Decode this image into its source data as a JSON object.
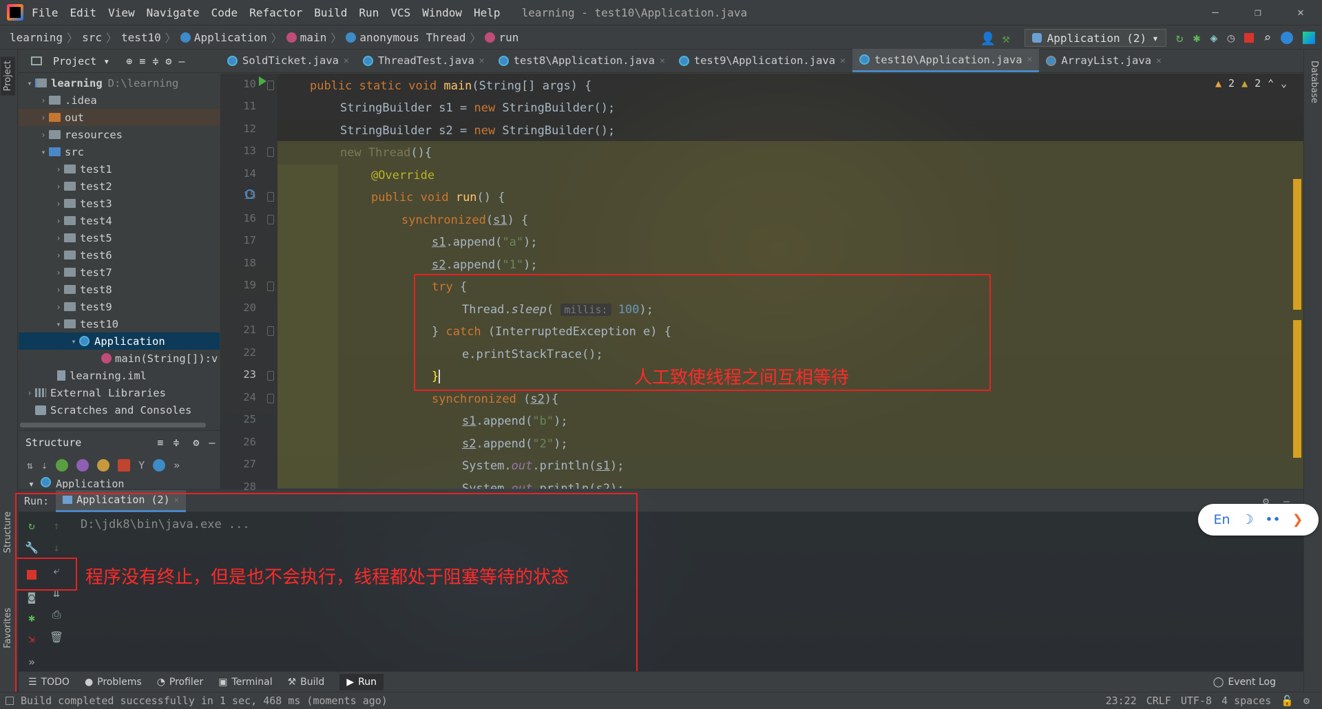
{
  "titlebar": {
    "menu": [
      "File",
      "Edit",
      "View",
      "Navigate",
      "Code",
      "Refactor",
      "Build",
      "Run",
      "VCS",
      "Window",
      "Help"
    ],
    "title": "learning - test10\\Application.java",
    "win_min": "—",
    "win_max": "❐",
    "win_close": "✕"
  },
  "navbar": {
    "breadcrumbs": [
      "learning",
      "src",
      "test10",
      "Application",
      "main",
      "anonymous Thread",
      "run"
    ],
    "run_config": "Application (2)"
  },
  "project_panel": {
    "title": "Project",
    "root_name": "learning",
    "root_path": "D:\\learning",
    "items": [
      ".idea",
      "out",
      "resources",
      "src",
      "test1",
      "test2",
      "test3",
      "test4",
      "test5",
      "test6",
      "test7",
      "test8",
      "test9",
      "test10",
      "Application",
      "main(String[]):v",
      "learning.iml",
      "External Libraries",
      "Scratches and Consoles"
    ]
  },
  "structure_panel": {
    "title": "Structure",
    "root_item": "Application"
  },
  "editor": {
    "tabs": [
      "SoldTicket.java",
      "ThreadTest.java",
      "test8\\Application.java",
      "test9\\Application.java",
      "test10\\Application.java",
      "ArrayList.java"
    ],
    "active_tab": "test10\\Application.java",
    "warnings": "2",
    "weak_warnings": "2",
    "line_numbers": [
      "10",
      "11",
      "12",
      "13",
      "14",
      "15",
      "16",
      "17",
      "18",
      "19",
      "20",
      "21",
      "22",
      "23",
      "24",
      "25",
      "26",
      "27",
      "28"
    ],
    "current_line": "23",
    "code": {
      "l10_a": "public static void ",
      "l10_fn": "main",
      "l10_b": "(String[] args) {",
      "l11": "StringBuilder s1 = ",
      "l11_kw": "new",
      "l11_b": " StringBuilder();",
      "l12": "StringBuilder s2 = ",
      "l12_kw": "new",
      "l12_b": " StringBuilder();",
      "l13_dim": "new Thread",
      "l13_b": "(){",
      "l14": "@Override",
      "l15_a": "public void ",
      "l15_fn": "run",
      "l15_b": "() {",
      "l16_kw": "synchronized",
      "l16_var": "s1",
      "l16_b": ") {",
      "l17_var": "s1",
      "l17_a": ".append(",
      "l17_str": "\"a\"",
      "l17_b": ");",
      "l18_var": "s2",
      "l18_a": ".append(",
      "l18_str": "\"1\"",
      "l18_b": ");",
      "l19_kw": "try",
      "l19_b": " {",
      "l20_a": "Thread.",
      "l20_fn": "sleep",
      "l20_hint": "millis:",
      "l20_num": "100",
      "l20_b": ");",
      "l21_a": "} ",
      "l21_kw": "catch",
      "l21_b": " (InterruptedException e) {",
      "l22": "e.printStackTrace();",
      "l23": "}",
      "l24_kw": "synchronized",
      "l24_var": "s2",
      "l24_b": "){",
      "l25_var": "s1",
      "l25_a": ".append(",
      "l25_str": "\"b\"",
      "l25_b": ");",
      "l26_var": "s2",
      "l26_a": ".append(",
      "l26_str": "\"2\"",
      "l26_b": ");",
      "l27_a": "System.",
      "l27_out": "out",
      "l27_b": ".println(",
      "l27_var": "s1",
      "l27_c": ");",
      "l28_a": "System.",
      "l28_out": "out",
      "l28_b": ".println(",
      "l28_var": "s2",
      "l28_c": ");"
    },
    "annotation_deadlock": "人工致使线程之间互相等待"
  },
  "run_panel": {
    "label": "Run:",
    "tab": "Application (2)",
    "console_line": "D:\\jdk8\\bin\\java.exe ...",
    "annotation_blocked": "程序没有终止，但是也不会执行，线程都处于阻塞等待的状态"
  },
  "side_tabs": {
    "project": "Project",
    "structure": "Structure",
    "favorites": "Favorites",
    "database": "Database"
  },
  "bottom_tabs": [
    "TODO",
    "Problems",
    "Profiler",
    "Terminal",
    "Build",
    "Run"
  ],
  "event_log": "Event Log",
  "statusbar": {
    "message": "Build completed successfully in 1 sec, 468 ms (moments ago)",
    "position": "23:22",
    "line_sep": "CRLF",
    "encoding": "UTF-8",
    "indent": "4 spaces"
  },
  "ime": {
    "lang": "En"
  },
  "colors": {
    "annotation_red": "#e52323",
    "selection": "#0d3a58",
    "keyword": "#cc7832"
  }
}
